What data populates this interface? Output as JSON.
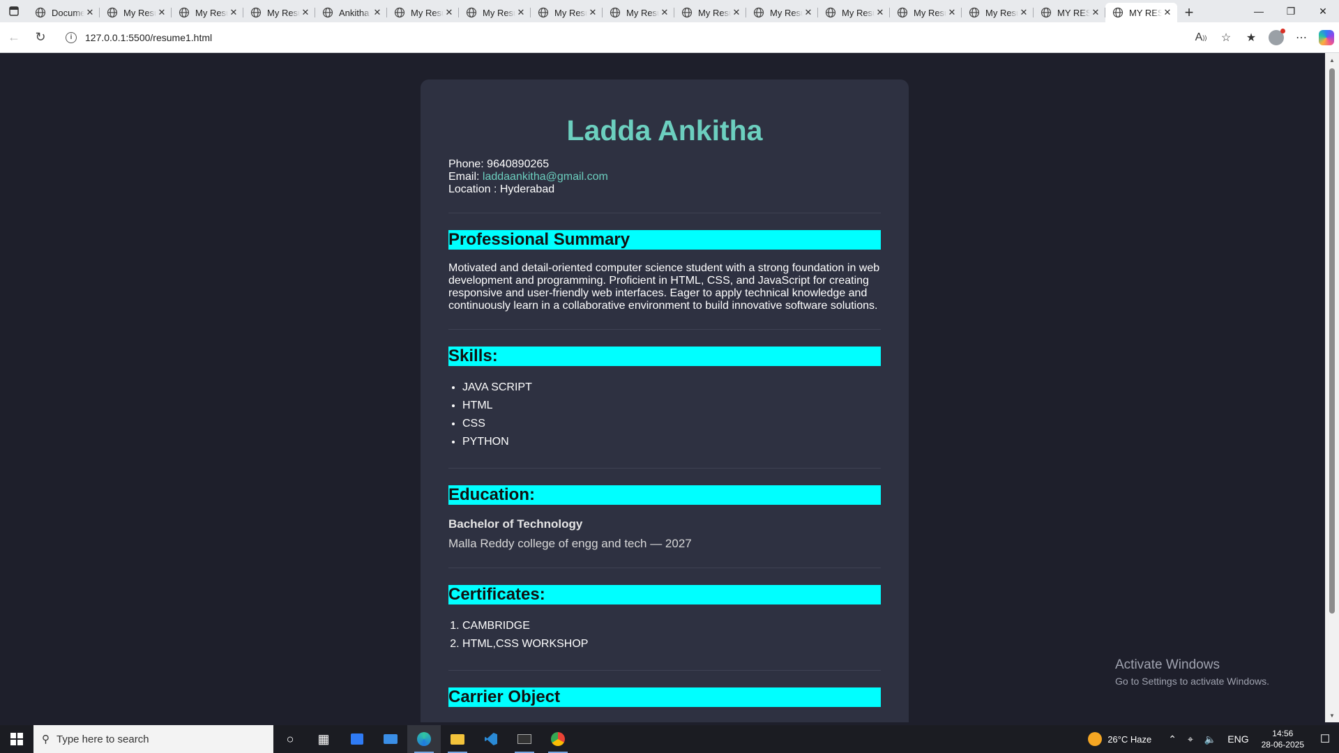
{
  "browser": {
    "tabs": [
      {
        "title": "Docume"
      },
      {
        "title": "My Resu"
      },
      {
        "title": "My Resu"
      },
      {
        "title": "My Resu"
      },
      {
        "title": "Ankitha"
      },
      {
        "title": "My Resu"
      },
      {
        "title": "My Resu"
      },
      {
        "title": "My Resu"
      },
      {
        "title": "My Resu"
      },
      {
        "title": "My Resu"
      },
      {
        "title": "My Resu"
      },
      {
        "title": "My Resu"
      },
      {
        "title": "My Resu"
      },
      {
        "title": "My Resu"
      },
      {
        "title": "MY RES"
      },
      {
        "title": "MY RES",
        "active": true
      }
    ],
    "url": "127.0.0.1:5500/resume1.html",
    "new_tab_symbol": "+"
  },
  "resume": {
    "name": "Ladda Ankitha",
    "phone_label": "Phone:",
    "phone": "9640890265",
    "email_label": "Email:",
    "email": "laddaankitha@gmail.com",
    "location_label": "Location :",
    "location": "Hyderabad",
    "summary_title": "Professional Summary",
    "summary": "Motivated and detail-oriented computer science student with a strong foundation in web development and programming. Proficient in HTML, CSS, and JavaScript for creating responsive and user-friendly web interfaces. Eager to apply technical knowledge and continuously learn in a collaborative environment to build innovative software solutions.",
    "skills_title": "Skills:",
    "skills": [
      "JAVA SCRIPT",
      "HTML",
      "CSS",
      "PYTHON"
    ],
    "education_title": "Education:",
    "degree": "Bachelor of Technology",
    "college": "Malla Reddy college of engg and tech — 2027",
    "certificates_title": "Certificates:",
    "certificates": [
      "CAMBRIDGE",
      "HTML,CSS WORKSHOP"
    ],
    "career_title": "Carrier Object"
  },
  "watermark": {
    "line1": "Activate Windows",
    "line2": "Go to Settings to activate Windows."
  },
  "taskbar": {
    "search_placeholder": "Type here to search",
    "weather": "26°C  Haze",
    "language": "ENG",
    "time": "14:56",
    "date": "28-06-2025"
  },
  "colors": {
    "page_bg": "#1e1f2b",
    "card_bg": "#2e3141",
    "name_accent": "#6ccfbf",
    "section_header": "#00ffff"
  }
}
